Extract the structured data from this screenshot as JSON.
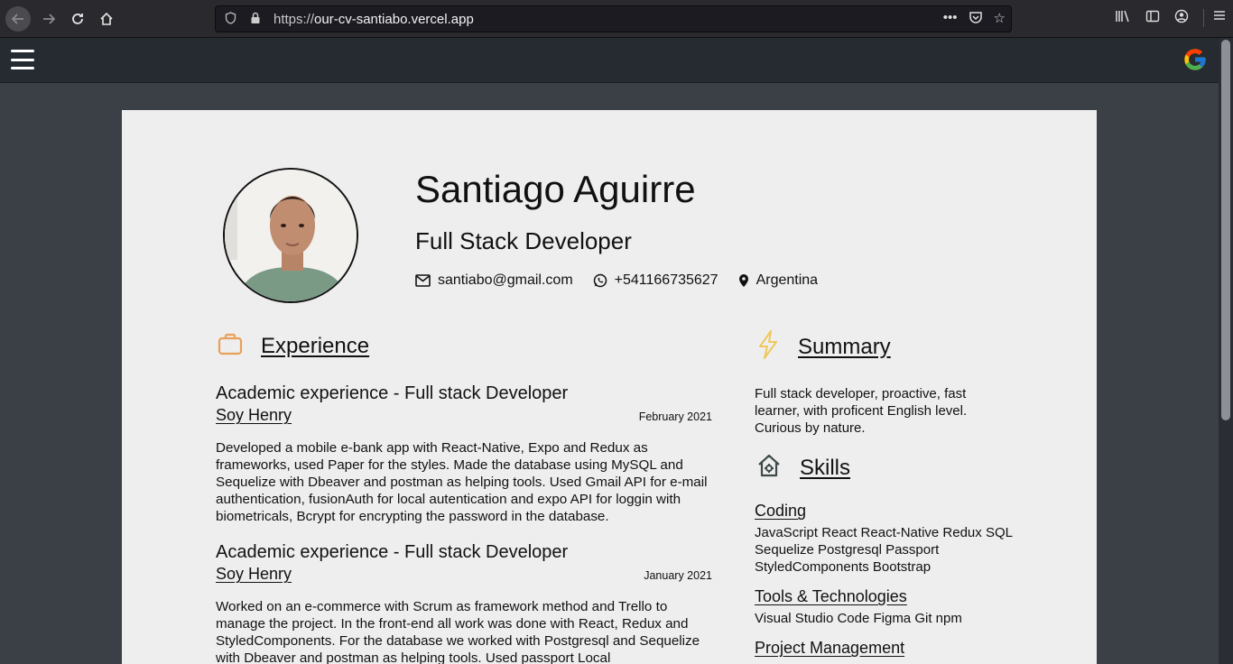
{
  "browser": {
    "url_scheme": "https://",
    "url_host": "our-cv-santiabo.vercel.app"
  },
  "profile": {
    "name": "Santiago Aguirre",
    "role": "Full Stack Developer",
    "email": "santiabo@gmail.com",
    "phone": "+541166735627",
    "location": "Argentina"
  },
  "experience": {
    "title": "Experience",
    "jobs": [
      {
        "title": "Academic experience - Full stack Developer",
        "company": "Soy Henry",
        "date": "February 2021",
        "description": "Developed a mobile e-bank app with React-Native, Expo and Redux as frameworks, used Paper for the styles. Made the database using MySQL and Sequelize with Dbeaver and postman as helping tools. Used Gmail API for e-mail authentication, fusionAuth for local autentication and expo API for loggin with biometricals, Bcrypt for encrypting the password in the database."
      },
      {
        "title": "Academic experience - Full stack Developer",
        "company": "Soy Henry",
        "date": "January 2021",
        "description": "Worked on an e-commerce with Scrum as framework method and Trello to manage the project. In the front-end all work was done with React, Redux and StyledComponents. For the database we worked with Postgresql and Sequelize with Dbeaver and postman as helping tools. Used passport Local"
      }
    ]
  },
  "summary": {
    "title": "Summary",
    "text": "Full stack developer, proactive, fast learner, with proficent English level. Curious by nature."
  },
  "skills": {
    "title": "Skills",
    "groups": [
      {
        "name": "Coding",
        "items": "JavaScript React React-Native Redux SQL Sequelize Postgresql Passport StyledComponents Bootstrap"
      },
      {
        "name": "Tools & Technologies",
        "items": "Visual Studio Code Figma Git npm"
      },
      {
        "name": "Project Management",
        "items": ""
      }
    ]
  },
  "colors": {
    "accent_briefcase": "#e8a05a",
    "accent_bolt": "#f0c85a",
    "accent_house": "#3e4a4a"
  }
}
